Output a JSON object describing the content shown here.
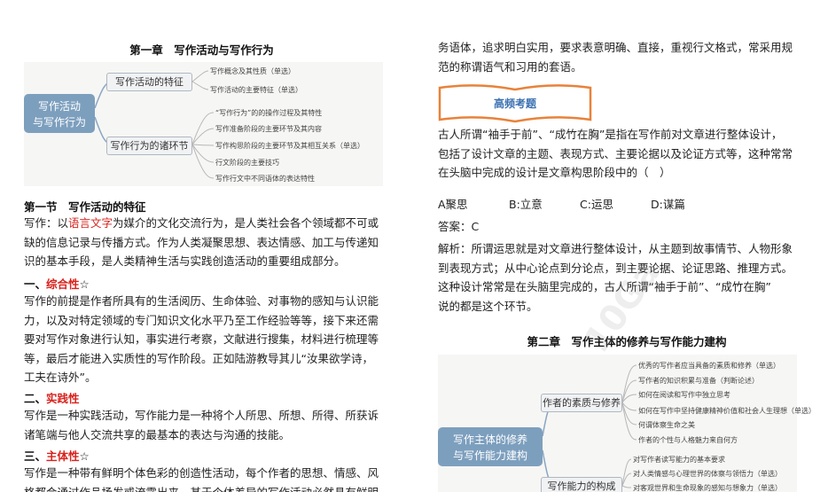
{
  "left": {
    "chapter_title": "第一章　写作活动与写作行为",
    "mindmap": {
      "center": [
        "写作活动",
        "与写作行为"
      ],
      "branches": [
        {
          "label": "写作活动的特征",
          "leaves": [
            "写作概念及其性质（单选）",
            "写作活动的主要特征（单选）"
          ]
        },
        {
          "label": "写作行为的诸环节",
          "leaves": [
            "“写作行为”的的操作过程及其特性",
            "写作准备阶段的主要环节及其内容",
            "写作构思阶段的主要环节及其相互关系（单选）",
            "行文阶段的主要技巧",
            "写作行文中不同语体的表达特性"
          ]
        }
      ]
    },
    "section_title": "第一节　写作活动的特征",
    "def_prefix": "写作：以",
    "def_red": "语言文字",
    "def_rest": "为媒介的文化交流行为，是人类社会各个领域都不可或",
    "def_lines": [
      "缺的信息记录与传播方式。作为人类凝聚思想、表达情感、加工与传递知",
      "识的基本手段，是人类精神生活与实践创造活动的重要组成部分。"
    ],
    "h1_prefix": "一、",
    "h1_red": "综合性",
    "h1_star": "☆",
    "p1_lines": [
      "写作的前提是作者所具有的生活阅历、生命体验、对事物的感知与认识能",
      "力，以及对特定领域的专门知识文化水平乃至工作经验等等，接下来还需",
      "要对写作对象进行认知，事实进行考察，文献进行搜集，材料进行梳理等",
      "等，最后才能进入实质性的写作阶段。正如陆游教导其儿“汝果欲学诗，",
      "工夫在诗外”。"
    ],
    "h2_prefix": "二、",
    "h2_red": "实践性",
    "p2_lines": [
      "写作是一种实践活动，写作能力是一种将个人所思、所想、所得、所获诉",
      "诸笔端与他人交流共享的最基本的表达与沟通的技能。"
    ],
    "h3_prefix": "三、",
    "h3_red": "主体性",
    "h3_star": "☆",
    "p3_lines": [
      "写作是一种带有鲜明个体色彩的创造性活动，每个作者的思想、情感、风",
      "格都会通过作品扬发或流露出来，甚于个体差异的写作活动必然具有鲜明"
    ]
  },
  "right": {
    "top_lines": [
      "务语体，追求明白实用，要求表意明确、直接，重视行文格式，常采用规",
      "范的称谓语气和习用的套语。"
    ],
    "banner_label": "高频考题",
    "question_lines": [
      "古人所谓“袖手于前”、“成竹在胸”是指在写作前对文章进行整体设计，",
      "包括了设计文章的主题、表现方式、主要论据以及论证方式等，这种常常",
      "在头脑中完成的设计是文章构思阶段中的（　）"
    ],
    "options": [
      "A聚思",
      "B:立意",
      "C:运思",
      "D:谋篇"
    ],
    "answer": "答案：C",
    "analysis_lines": [
      "解析：所谓运思就是对文章进行整体设计，从主题到故事情节、人物形象",
      "到表现方式；从中心论点到分论点，到主要论据、论证思路、推理方式。",
      "这种设计常常是在头脑里完成的，古人所谓“袖手于前”、“成竹在胸”",
      "说的都是这个环节。"
    ],
    "chapter2_title": "第二章　写作主体的修养与写作能力建构",
    "mindmap": {
      "center": [
        "写作主体的修养",
        "与写作能力建构"
      ],
      "branches": [
        {
          "label": "作者的素质与修养",
          "leaves": [
            "优秀的写作者应当具备的素质和修养（单选）",
            "写作者的知识积累与准备（判断论述）",
            "如何在阅读和写作中独立思考",
            "如何在写作中坚持健康精神价值和社会人生理想（单选）",
            "何谓体察生命之美",
            "作者的个性与人格魅力来自何方"
          ]
        },
        {
          "label": "写作能力的构成",
          "leaves": [
            "对写作者读写能力的基本要求",
            "对人类情感与心理世界的体察与领悟力（单选）",
            "对客观世界和生命现象的感知与想象力（单选）"
          ]
        }
      ]
    },
    "watermark": "10Ga"
  }
}
